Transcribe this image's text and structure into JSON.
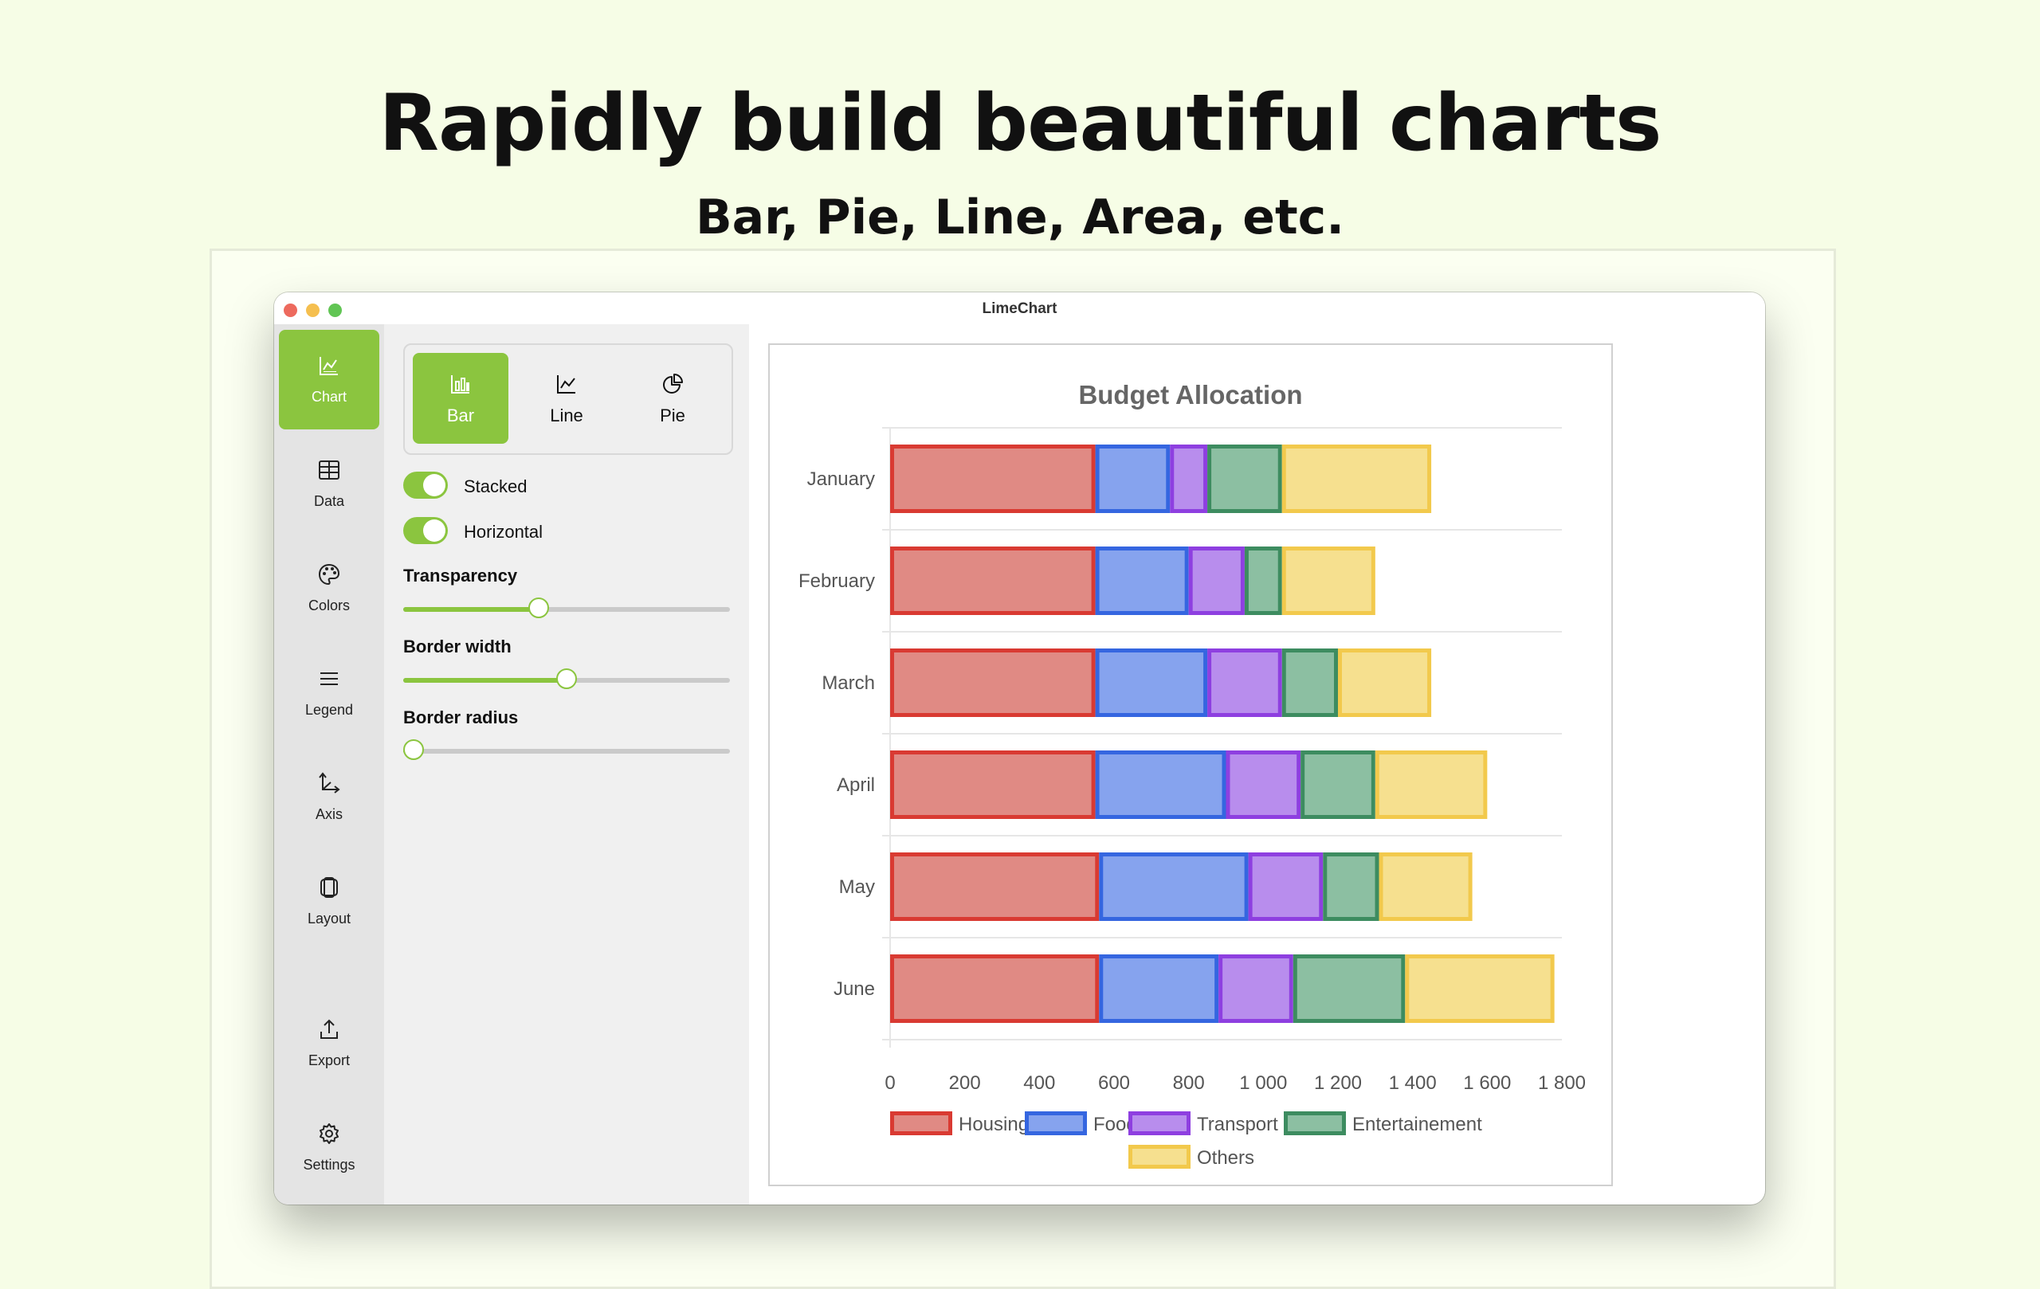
{
  "hero": {
    "title": "Rapidly build beautiful charts",
    "subtitle": "Bar, Pie, Line, Area, etc."
  },
  "window": {
    "title": "LimeChart"
  },
  "colors": {
    "accent": "#8bc53f"
  },
  "sidebar": {
    "items": [
      {
        "label": "Chart",
        "icon": "chart-icon",
        "active": true
      },
      {
        "label": "Data",
        "icon": "table-icon",
        "active": false
      },
      {
        "label": "Colors",
        "icon": "palette-icon",
        "active": false
      },
      {
        "label": "Legend",
        "icon": "list-icon",
        "active": false
      },
      {
        "label": "Axis",
        "icon": "axis-icon",
        "active": false
      },
      {
        "label": "Layout",
        "icon": "layout-icon",
        "active": false
      },
      {
        "label": "Export",
        "icon": "export-icon",
        "active": false
      },
      {
        "label": "Settings",
        "icon": "gear-icon",
        "active": false
      }
    ]
  },
  "panel": {
    "chart_types": [
      {
        "label": "Bar",
        "icon": "bar-chart-icon",
        "active": true
      },
      {
        "label": "Line",
        "icon": "line-chart-icon",
        "active": false
      },
      {
        "label": "Pie",
        "icon": "pie-chart-icon",
        "active": false
      }
    ],
    "toggles": [
      {
        "label": "Stacked",
        "on": true
      },
      {
        "label": "Horizontal",
        "on": true
      }
    ],
    "sliders": [
      {
        "label": "Transparency",
        "value": 0.41
      },
      {
        "label": "Border width",
        "value": 0.5
      },
      {
        "label": "Border radius",
        "value": 0.0
      }
    ]
  },
  "chart_data": {
    "type": "bar",
    "orientation": "horizontal",
    "stacked": true,
    "title": "Budget Allocation",
    "categories": [
      "January",
      "February",
      "March",
      "April",
      "May",
      "June"
    ],
    "series": [
      {
        "name": "Housing",
        "color": "#d93a32",
        "fill": "#e08a84",
        "values": [
          550,
          550,
          550,
          550,
          560,
          560
        ]
      },
      {
        "name": "Food",
        "color": "#3566e0",
        "fill": "#86a3ee",
        "values": [
          200,
          250,
          300,
          350,
          400,
          320
        ]
      },
      {
        "name": "Transport",
        "color": "#8e3fe0",
        "fill": "#b88ded",
        "values": [
          100,
          150,
          200,
          200,
          200,
          200
        ]
      },
      {
        "name": "Entertainement",
        "color": "#3d8c60",
        "fill": "#8cbfa2",
        "values": [
          200,
          100,
          150,
          200,
          150,
          300
        ]
      },
      {
        "name": "Others",
        "color": "#f2c94c",
        "fill": "#f6e08f",
        "values": [
          400,
          250,
          250,
          300,
          250,
          400
        ]
      }
    ],
    "xlim": [
      0,
      1800
    ],
    "x_ticks": [
      "0",
      "200",
      "400",
      "600",
      "800",
      "1 000",
      "1 200",
      "1 400",
      "1 600",
      "1 800"
    ],
    "legend_position": "bottom",
    "grid": true
  }
}
